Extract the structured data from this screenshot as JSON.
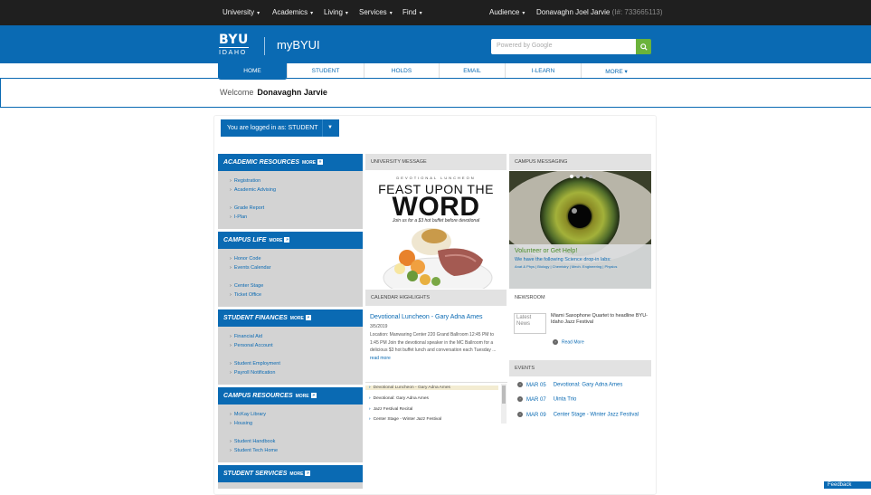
{
  "topbar": {
    "nav": [
      "University",
      "Academics",
      "Living",
      "Services",
      "Find"
    ],
    "audience": "Audience",
    "user_name": "Donavaghn Joel Jarvie",
    "user_id": "(I#: 733665113)"
  },
  "header": {
    "logo_top": "BYU",
    "logo_bottom": "IDAHO",
    "site_title": "myBYUI",
    "search_placeholder": "Powered by Google"
  },
  "tabs": [
    "HOME",
    "STUDENT",
    "HOLDS",
    "EMAIL",
    "I-LEARN",
    "MORE"
  ],
  "welcome": {
    "label": "Welcome",
    "name": "Donavaghn Jarvie"
  },
  "role": {
    "prefix": "You are logged in as:",
    "value": "STUDENT"
  },
  "resources": [
    {
      "title": "ACADEMIC RESOURCES",
      "more": "MORE",
      "links": [
        "Registration",
        "Academic Advising",
        "Grade Report",
        "I-Plan"
      ]
    },
    {
      "title": "CAMPUS LIFE",
      "more": "MORE",
      "links": [
        "Honor Code",
        "Events Calendar",
        "Center Stage",
        "Ticket Office"
      ]
    },
    {
      "title": "STUDENT FINANCES",
      "more": "MORE",
      "links": [
        "Financial Aid",
        "Personal Account",
        "Student Employment",
        "Payroll Notification"
      ]
    },
    {
      "title": "CAMPUS RESOURCES",
      "more": "MORE",
      "links": [
        "McKay Library",
        "Housing",
        "Student Handbook",
        "Student Tech Home"
      ]
    },
    {
      "title": "STUDENT SERVICES",
      "more": "MORE",
      "links": []
    }
  ],
  "university_message": {
    "heading": "UNIVERSITY MESSAGE",
    "kicker": "DEVOTIONAL LUNCHEON",
    "line1": "FEAST UPON THE",
    "line2": "WORD",
    "sub": "Join us for a $3 hot buffet before devotional"
  },
  "campus_messaging": {
    "heading": "CAMPUS MESSAGING",
    "caption_title": "Volunteer or Get Help!",
    "caption_body": "We have the following Science drop-in labs:",
    "caption_subjects": "Anat & Phys | Biology | Chemistry | Mech. Engineering | Physics"
  },
  "calendar": {
    "heading": "CALENDAR HIGHLIGHTS",
    "featured_title": "Devotional Luncheon - Gary Adna Ames",
    "featured_date": "3/5/2019",
    "featured_desc": "Location: Manwaring Center 220 Grand Ballroom 12:45 PM to 1:45 PM Join the devotional speaker in the MC Ballroom for a delicious $3 hot buffet lunch and conversation each Tuesday ...",
    "read_more": "read more",
    "items": [
      "Devotional Luncheon - Gary Adna Ames",
      "Devotional: Gary Adna Ames",
      "Jazz Festival Recital",
      "Center Stage - Winter Jazz Festival"
    ]
  },
  "newsroom": {
    "heading": "NEWSROOM",
    "img_alt": "Latest News",
    "headline": "Miami Saxophone Quartet to headline BYU-Idaho Jazz Festival",
    "read_more": "Read More"
  },
  "events": {
    "heading": "EVENTS",
    "items": [
      {
        "date": "MAR 05",
        "title": "Devotional: Gary Adna Ames"
      },
      {
        "date": "MAR 07",
        "title": "Uinta Trio"
      },
      {
        "date": "MAR 09",
        "title": "Center Stage - Winter Jazz Festival"
      }
    ]
  },
  "feedback": "Feedback",
  "colors": {
    "brand_blue": "#0a6ab3",
    "search_green": "#6bb33b",
    "topbar": "#1f1f1f"
  }
}
